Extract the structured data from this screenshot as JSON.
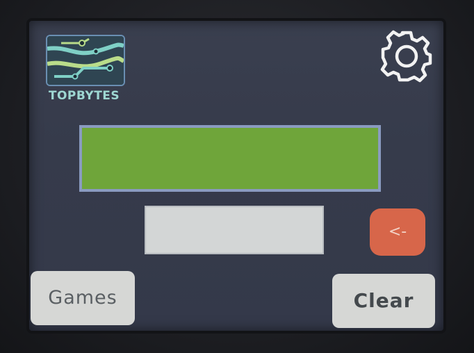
{
  "logo": {
    "text": "TOPBYTES",
    "icon": "circuit-board-icon"
  },
  "settings": {
    "icon": "gear-icon"
  },
  "display": {
    "value": ""
  },
  "input": {
    "value": ""
  },
  "buttons": {
    "backspace_label": "<-",
    "games_label": "Games",
    "clear_label": "Clear"
  },
  "colors": {
    "display_green": "#6fa53a",
    "backspace_red": "#d7664a",
    "logo_teal": "#9ed7d2",
    "screen_bg": "#363b4b"
  }
}
